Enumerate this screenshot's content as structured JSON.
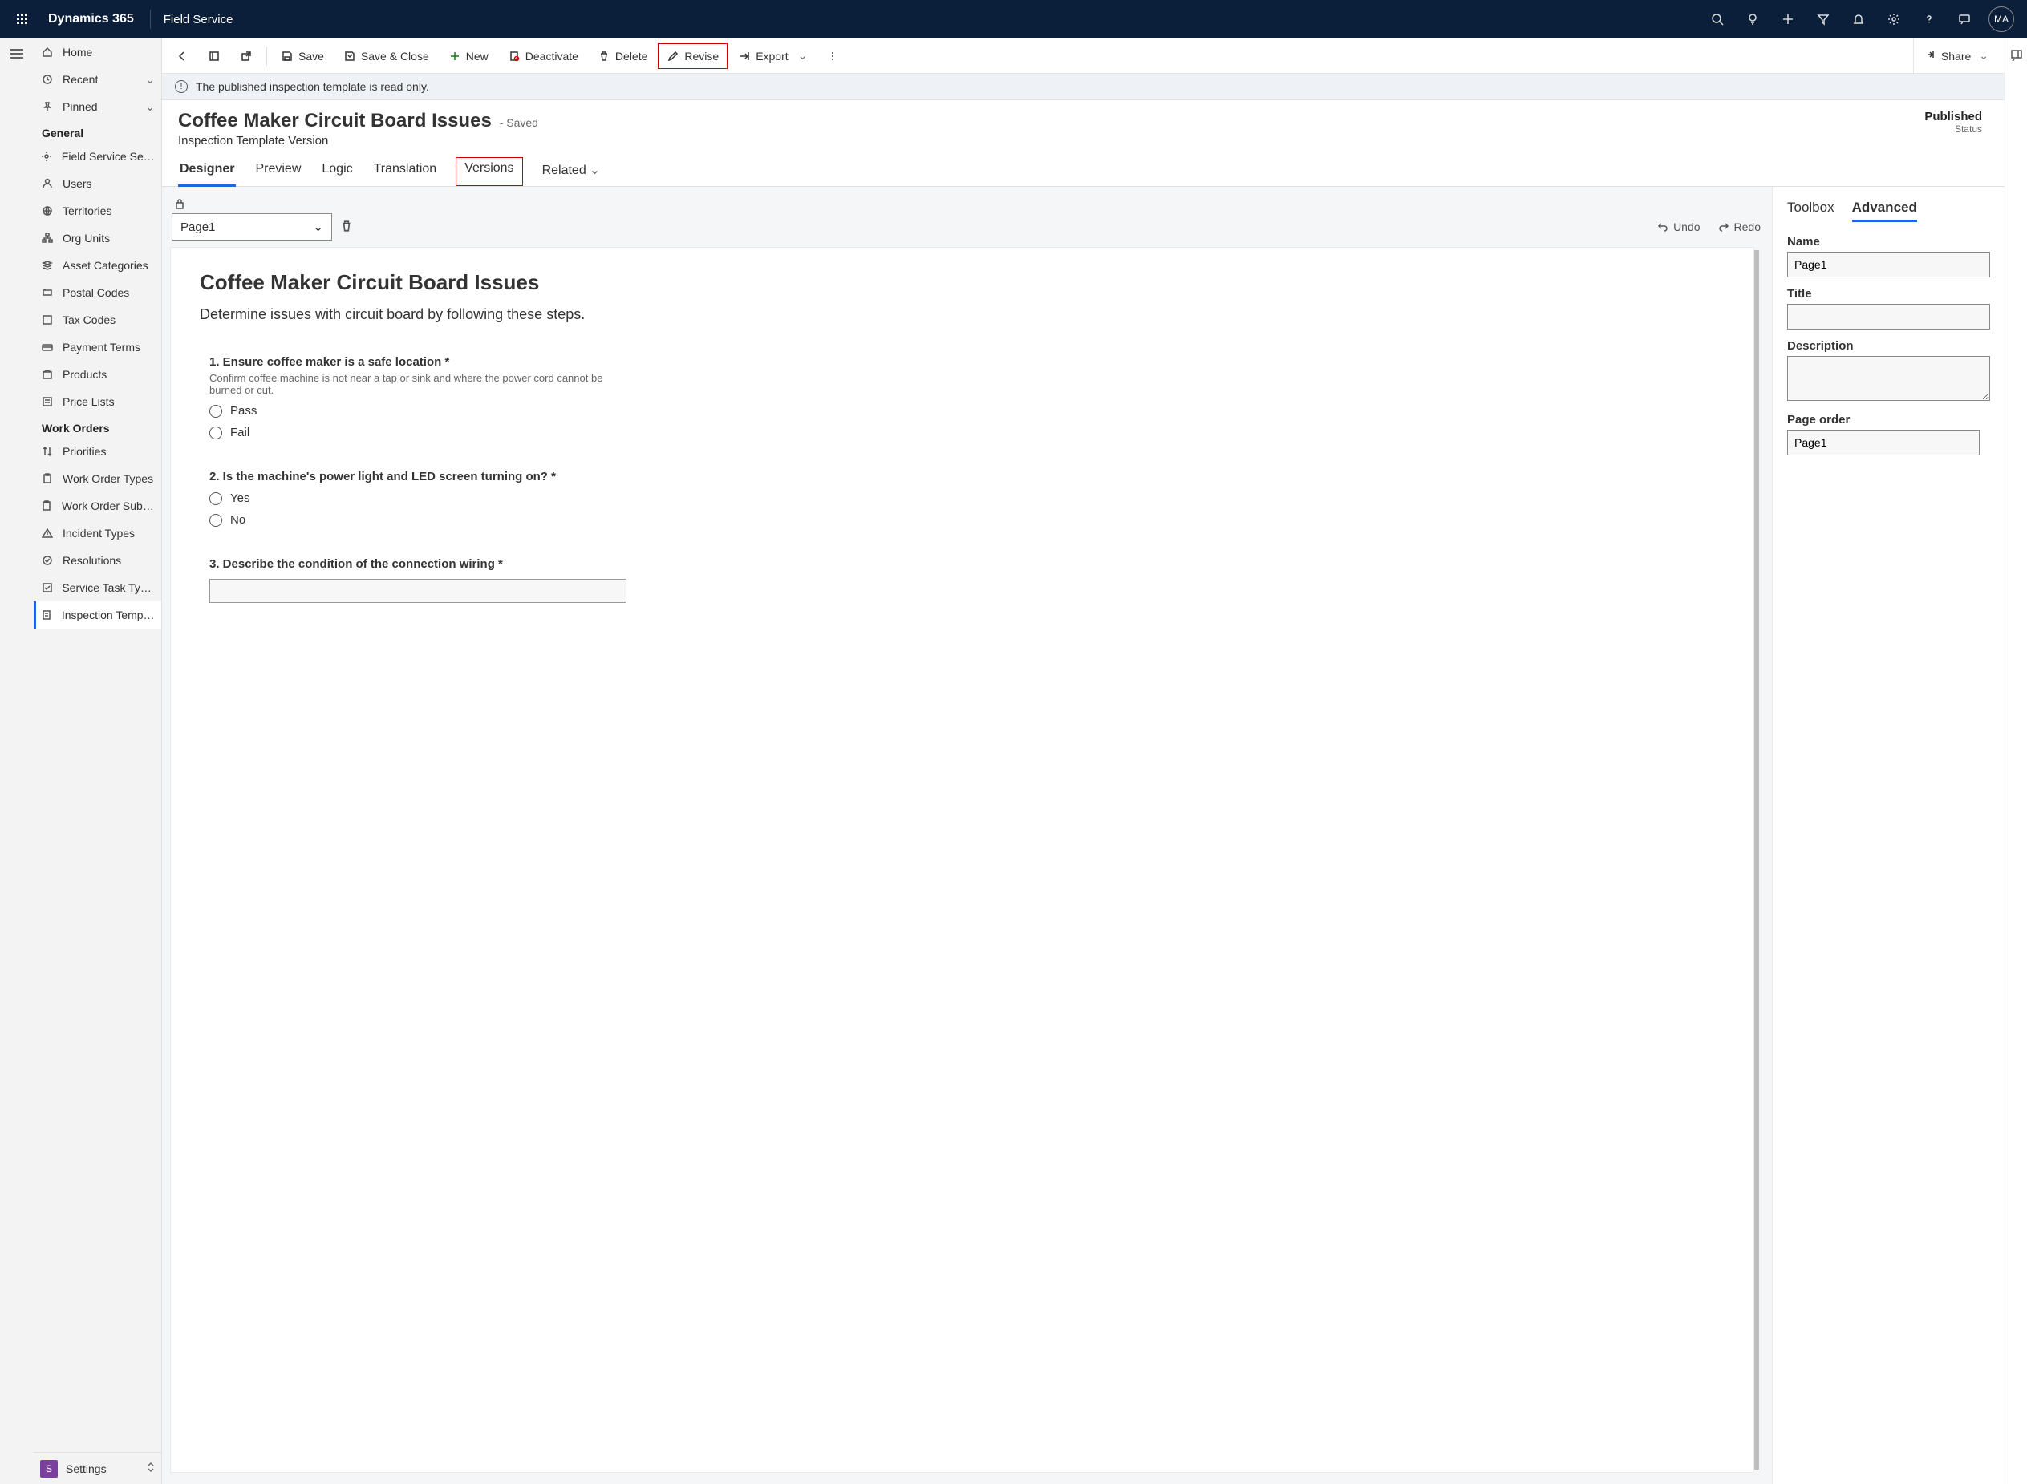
{
  "topbar": {
    "brand": "Dynamics 365",
    "module": "Field Service",
    "avatar": "MA"
  },
  "cmdbar": {
    "save": "Save",
    "save_close": "Save & Close",
    "new": "New",
    "deactivate": "Deactivate",
    "delete": "Delete",
    "revise": "Revise",
    "export": "Export",
    "share": "Share"
  },
  "infostrip": {
    "text": "The published inspection template is read only."
  },
  "record": {
    "title": "Coffee Maker Circuit Board Issues",
    "saved_suffix": "- Saved",
    "subtitle": "Inspection Template Version",
    "status_value": "Published",
    "status_label": "Status"
  },
  "tabs": {
    "designer": "Designer",
    "preview": "Preview",
    "logic": "Logic",
    "translation": "Translation",
    "versions": "Versions",
    "related": "Related"
  },
  "leftnav": {
    "top": {
      "home": "Home",
      "recent": "Recent",
      "pinned": "Pinned"
    },
    "section1": "General",
    "general": {
      "fss": "Field Service Setti...",
      "users": "Users",
      "territories": "Territories",
      "org_units": "Org Units",
      "asset_categories": "Asset Categories",
      "postal_codes": "Postal Codes",
      "tax_codes": "Tax Codes",
      "payment_terms": "Payment Terms",
      "products": "Products",
      "price_lists": "Price Lists"
    },
    "section2": "Work Orders",
    "wo": {
      "priorities": "Priorities",
      "wo_types": "Work Order Types",
      "wo_subst": "Work Order Subst...",
      "incident_types": "Incident Types",
      "resolutions": "Resolutions",
      "service_task_types": "Service Task Types",
      "inspection_templates": "Inspection Templa..."
    },
    "footer": {
      "badge": "S",
      "label": "Settings"
    }
  },
  "designer": {
    "page_selector": "Page1",
    "undo": "Undo",
    "redo": "Redo",
    "canvas_title": "Coffee Maker Circuit Board Issues",
    "canvas_desc": "Determine issues with circuit board by following these steps.",
    "q1": {
      "title": "1. Ensure coffee maker is a safe location *",
      "help": "Confirm coffee machine is not near a tap or sink and where the power cord cannot be burned or cut.",
      "opt1": "Pass",
      "opt2": "Fail"
    },
    "q2": {
      "title": "2. Is the machine's power light and LED screen turning on? *",
      "opt1": "Yes",
      "opt2": "No"
    },
    "q3": {
      "title": "3. Describe the condition of the connection wiring *"
    }
  },
  "rightpanel": {
    "toolbox": "Toolbox",
    "advanced": "Advanced",
    "name_label": "Name",
    "name_value": "Page1",
    "title_label": "Title",
    "title_value": "",
    "desc_label": "Description",
    "desc_value": "",
    "pageorder_label": "Page order",
    "pageorder_value": "Page1"
  }
}
